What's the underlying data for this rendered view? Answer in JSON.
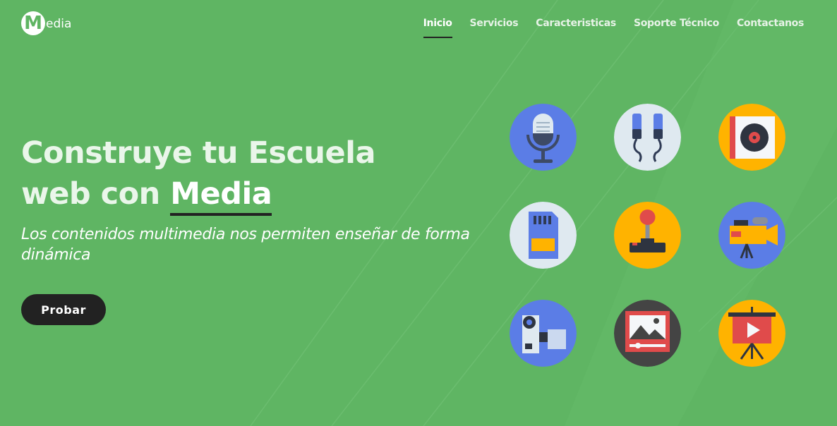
{
  "brand": {
    "logo_letter": "M",
    "logo_text": "edia"
  },
  "nav": [
    {
      "label": "Inicio",
      "active": true
    },
    {
      "label": "Servicios",
      "active": false
    },
    {
      "label": "Caracteristicas",
      "active": false
    },
    {
      "label": "Soporte Técnico",
      "active": false
    },
    {
      "label": "Contactanos",
      "active": false
    }
  ],
  "hero": {
    "title_line1": "Construye tu Escuela",
    "title_line2_prefix": "web con ",
    "title_accent": "Media",
    "subtitle": "Los contenidos multimedia nos permiten enseñar de forma dinámica",
    "cta_label": "Probar"
  },
  "icons": [
    "microphone-icon",
    "headphones-icon",
    "vinyl-record-icon",
    "sd-card-icon",
    "joystick-icon",
    "video-camera-icon",
    "film-camera-icon",
    "image-frame-icon",
    "presentation-play-icon"
  ],
  "colors": {
    "background": "#5fb563",
    "dark": "#222222",
    "text": "#ffffff",
    "icon_blue": "#5b7de6",
    "icon_yellow": "#ffb300",
    "icon_light": "#dfe9f0",
    "icon_dark": "#444444"
  }
}
